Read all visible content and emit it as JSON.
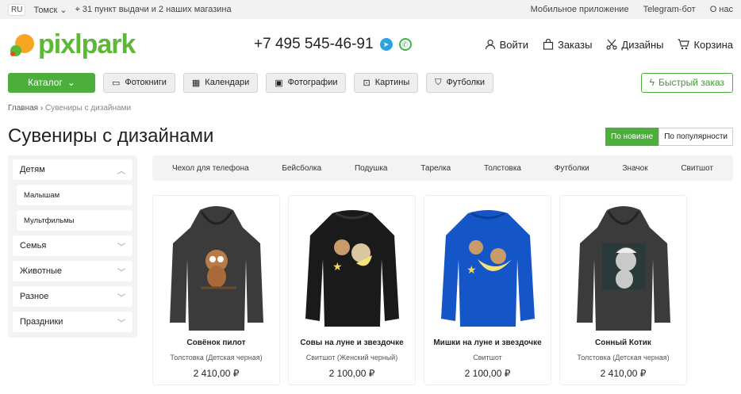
{
  "topbar": {
    "lang": "RU",
    "city": "Томск",
    "pickup": "31 пункт выдачи и 2 наших магазина",
    "links": [
      "Мобильное приложение",
      "Telegram-бот",
      "О нас"
    ]
  },
  "header": {
    "logo": "pixlpark",
    "phone": "+7 495 545-46-91",
    "nav": [
      {
        "label": "Войти",
        "icon": "user-icon"
      },
      {
        "label": "Заказы",
        "icon": "bag-icon"
      },
      {
        "label": "Дизайны",
        "icon": "scissors-icon"
      },
      {
        "label": "Корзина",
        "icon": "cart-icon"
      }
    ]
  },
  "catalog": {
    "button": "Каталог",
    "categories": [
      "Фотокниги",
      "Календари",
      "Фотографии",
      "Картины",
      "Футболки"
    ],
    "quick_order": "Быстрый заказ"
  },
  "breadcrumb": {
    "home": "Главная",
    "current": "Сувениры с дизайнами"
  },
  "page_title": "Сувениры с дизайнами",
  "sort": {
    "newest": "По новизне",
    "popular": "По популярности"
  },
  "sidebar": {
    "top": "Детям",
    "subitems": [
      "Малышам",
      "Мультфильмы"
    ],
    "items": [
      "Семья",
      "Животные",
      "Разное",
      "Праздники"
    ]
  },
  "tags": [
    "Чехол для телефона",
    "Бейсболка",
    "Подушка",
    "Тарелка",
    "Толстовка",
    "Футболки",
    "Значок",
    "Свитшот"
  ],
  "products": [
    {
      "name": "Совёнок пилот",
      "type": "Толстовка (Детская черная)",
      "price": "2 410,00 ₽",
      "color": "#3b3b3b"
    },
    {
      "name": "Совы на луне и звездочке",
      "type": "Свитшот (Женский черный)",
      "price": "2 100,00 ₽",
      "color": "#1a1a1a"
    },
    {
      "name": "Мишки на луне и звездочке",
      "type": "Свитшот",
      "price": "2 100,00 ₽",
      "color": "#1456c8"
    },
    {
      "name": "Сонный Котик",
      "type": "Толстовка (Детская черная)",
      "price": "2 410,00 ₽",
      "color": "#3b3b3b"
    }
  ],
  "colors": {
    "accent": "#4caf3c",
    "logo": "#5cb836"
  }
}
